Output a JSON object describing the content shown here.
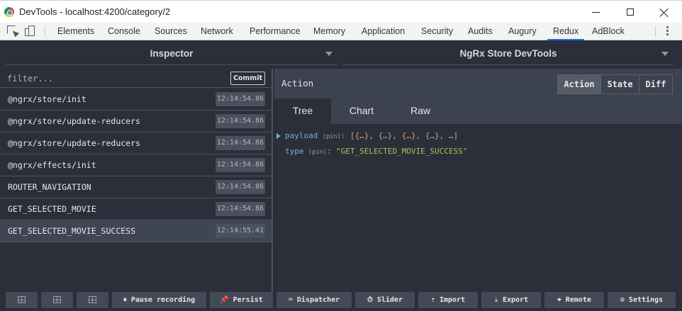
{
  "window": {
    "title": "DevTools - localhost:4200/category/2"
  },
  "devtools_tabs": [
    {
      "label": "Elements"
    },
    {
      "label": "Console"
    },
    {
      "label": "Sources"
    },
    {
      "label": "Network"
    },
    {
      "label": "Performance"
    },
    {
      "label": "Memory"
    },
    {
      "label": "Application"
    },
    {
      "label": "Security"
    },
    {
      "label": "Audits"
    },
    {
      "label": "Augury"
    },
    {
      "label": "Redux"
    },
    {
      "label": "AdBlock"
    }
  ],
  "active_tab": "Redux",
  "selectors": {
    "left": "Inspector",
    "right": "NgRx Store DevTools"
  },
  "filter": {
    "placeholder": "filter...",
    "commit_label": "Commit"
  },
  "actions": [
    {
      "name": "@ngrx/store/init",
      "time": "12:14:54.86"
    },
    {
      "name": "@ngrx/store/update-reducers",
      "time": "12:14:54.86"
    },
    {
      "name": "@ngrx/store/update-reducers",
      "time": "12:14:54.86"
    },
    {
      "name": "@ngrx/effects/init",
      "time": "12:14:54.86"
    },
    {
      "name": "ROUTER_NAVIGATION",
      "time": "12:14:54.86"
    },
    {
      "name": "GET_SELECTED_MOVIE",
      "time": "12:14:54.86"
    },
    {
      "name": "GET_SELECTED_MOVIE_SUCCESS",
      "time": "12:14:55.41",
      "selected": true
    }
  ],
  "inspector": {
    "heading": "Action",
    "segments": [
      "Action",
      "State",
      "Diff"
    ],
    "active_segment": "Action",
    "subtabs": [
      "Tree",
      "Chart",
      "Raw"
    ],
    "active_subtab": "Tree",
    "tree": {
      "payload_key": "payload",
      "payload_pin": "(pin)",
      "payload_value": "[{…}, {…}, {…}, {…}, …]",
      "type_key": "type",
      "type_pin": "(pin)",
      "type_value": "\"GET_SELECTED_MOVIE_SUCCESS\""
    }
  },
  "bottom_bar": {
    "pause": "Pause recording",
    "persist": "Persist",
    "dispatcher": "Dispatcher",
    "slider": "Slider",
    "import": "Import",
    "export": "Export",
    "remote": "Remote",
    "settings": "Settings"
  }
}
